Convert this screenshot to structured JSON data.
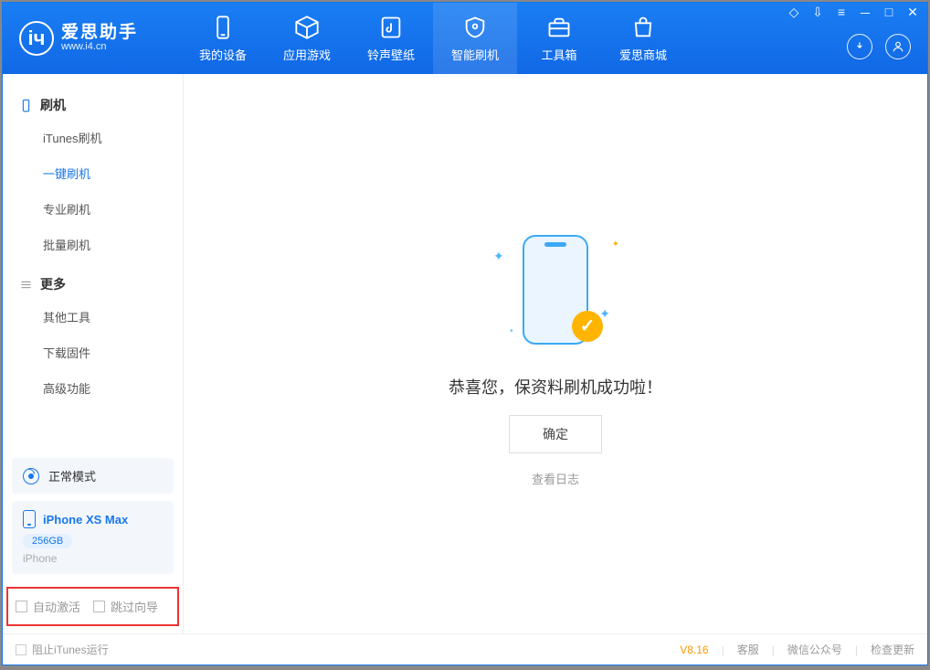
{
  "app": {
    "name_cn": "爱思助手",
    "url": "www.i4.cn"
  },
  "tabs": [
    {
      "label": "我的设备"
    },
    {
      "label": "应用游戏"
    },
    {
      "label": "铃声壁纸"
    },
    {
      "label": "智能刷机"
    },
    {
      "label": "工具箱"
    },
    {
      "label": "爱思商城"
    }
  ],
  "sidebar": {
    "group1": {
      "title": "刷机",
      "items": [
        "iTunes刷机",
        "一键刷机",
        "专业刷机",
        "批量刷机"
      ]
    },
    "group2": {
      "title": "更多",
      "items": [
        "其他工具",
        "下载固件",
        "高级功能"
      ]
    },
    "mode": "正常模式",
    "device": {
      "name": "iPhone XS Max",
      "storage": "256GB",
      "type": "iPhone"
    },
    "opts": {
      "auto_activate": "自动激活",
      "skip_guide": "跳过向导"
    }
  },
  "main": {
    "success": "恭喜您，保资料刷机成功啦！",
    "ok": "确定",
    "view_log": "查看日志"
  },
  "status": {
    "block_itunes": "阻止iTunes运行",
    "version": "V8.16",
    "links": [
      "客服",
      "微信公众号",
      "检查更新"
    ]
  },
  "colors": {
    "primary": "#1776ec",
    "accent": "#ffb400"
  }
}
